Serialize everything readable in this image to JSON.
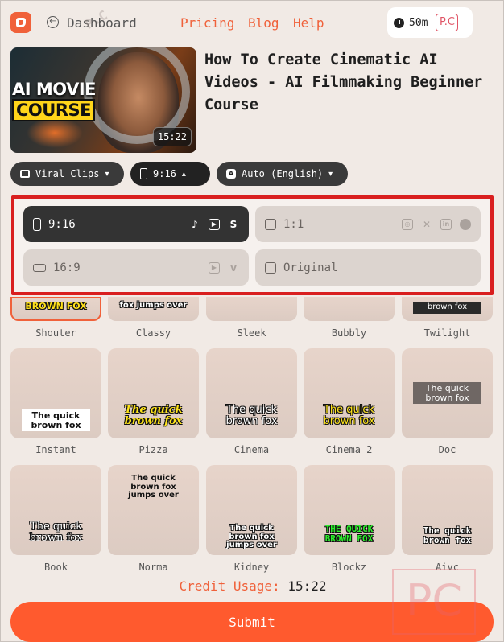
{
  "header": {
    "back_label": "Dashboard",
    "nav": [
      "Pricing",
      "Blog",
      "Help"
    ],
    "credits": "50m",
    "badge": "P.C"
  },
  "video": {
    "thumb_line1": "AI MOVIE",
    "thumb_line2": "COURSE",
    "duration": "15:22",
    "title": "How To Create Cinematic AI Videos - AI Filmmaking Beginner Course"
  },
  "toolbar": {
    "mode": "Viral Clips",
    "ratio": "9:16",
    "language": "Auto (English)"
  },
  "aspect_options": [
    {
      "label": "9:16",
      "selected": true,
      "icons": [
        "tiktok-icon",
        "youtube-shorts-icon",
        "shorts-icon"
      ]
    },
    {
      "label": "1:1",
      "selected": false,
      "icons": [
        "instagram-icon",
        "x-icon",
        "linkedin-icon",
        "facebook-icon"
      ]
    },
    {
      "label": "16:9",
      "selected": false,
      "icons": [
        "youtube-icon",
        "vimeo-icon"
      ]
    },
    {
      "label": "Original",
      "selected": false,
      "icons": []
    }
  ],
  "styles": {
    "row1": [
      "Shouter",
      "Classy",
      "Sleek",
      "Bubbly",
      "Twilight"
    ],
    "row1_samples": [
      "BROWN FOX",
      "fox jumps over",
      "",
      "",
      "brown fox"
    ],
    "row2": [
      "Instant",
      "Pizza",
      "Cinema",
      "Cinema 2",
      "Doc"
    ],
    "row2_samples": [
      "The quick brown fox",
      "The quick brown fox",
      "The quick brown fox",
      "The quick brown fox",
      "The quick brown fox"
    ],
    "row3": [
      "Book",
      "Norma",
      "Kidney",
      "Blockz",
      "Aivc"
    ],
    "row3_samples": [
      "The quick brown fox",
      "The quick brown fox jumps over",
      "The quick brown fox jumps over",
      "THE QUICK BROWN FOX",
      "The quick brown fox"
    ]
  },
  "credit_usage": {
    "label": "Credit Usage:",
    "value": "15:22"
  },
  "submit_label": "Submit",
  "watermark": "P.C",
  "colors": {
    "accent": "#f0613a",
    "submit": "#ff5a2e",
    "highlight_border": "#d91f1f"
  }
}
